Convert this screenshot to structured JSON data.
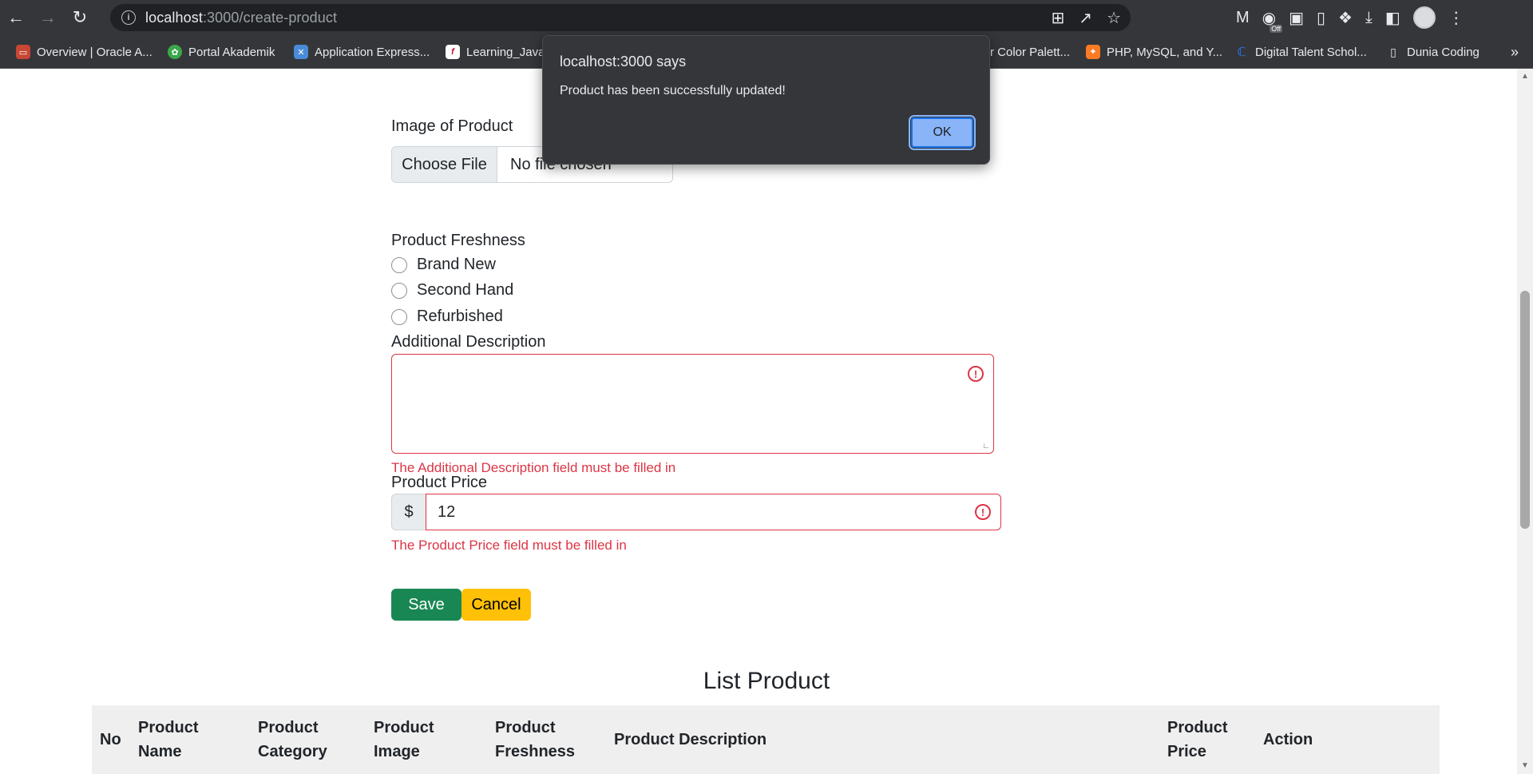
{
  "browser": {
    "url_host": "localhost",
    "url_path": ":3000/create-product",
    "bookmarks": [
      {
        "label": "Overview | Oracle A...",
        "icon": "oracle-icon",
        "color": "#c74634"
      },
      {
        "label": "Portal Akademik",
        "icon": "portal-icon",
        "color": "#3aa84a"
      },
      {
        "label": "Application Express...",
        "icon": "apex-icon",
        "color": "#4a8bd8"
      },
      {
        "label": "Learning_Java",
        "icon": "flash-icon",
        "color": "#ffffff"
      },
      {
        "label": "r Color Palett...",
        "icon": "",
        "color": ""
      },
      {
        "label": "PHP, MySQL, and Y...",
        "icon": "xampp-icon",
        "color": "#fb7a24"
      },
      {
        "label": "Digital Talent Schol...",
        "icon": "dts-icon",
        "color": "#2a6fdb"
      },
      {
        "label": "Dunia Coding",
        "icon": "page-icon",
        "color": "#e8eaed"
      }
    ],
    "more": "»",
    "ext_badge": "Off"
  },
  "form": {
    "image_label": "Image of Product",
    "file_button": "Choose File",
    "file_status": "No file chosen",
    "freshness_label": "Product Freshness",
    "freshness_options": [
      "Brand New",
      "Second Hand",
      "Refurbished"
    ],
    "description_label": "Additional Description",
    "description_value": "",
    "description_error": "The Additional Description field must be filled in",
    "price_label": "Product Price",
    "price_prefix": "$",
    "price_value": "12",
    "price_error": "The Product Price field must be filled in",
    "save_label": "Save",
    "cancel_label": "Cancel"
  },
  "list": {
    "title": "List Product",
    "columns": [
      "No",
      "Product Name",
      "Product Category",
      "Product Image",
      "Product Freshness",
      "Product Description",
      "Product Price",
      "Action"
    ]
  },
  "dialog": {
    "title": "localhost:3000 says",
    "message": "Product has been successfully updated!",
    "ok_label": "OK"
  },
  "colors": {
    "error": "#dc3545",
    "save": "#198754",
    "cancel": "#ffc107",
    "dialog_ok": "#8ab4f8"
  }
}
